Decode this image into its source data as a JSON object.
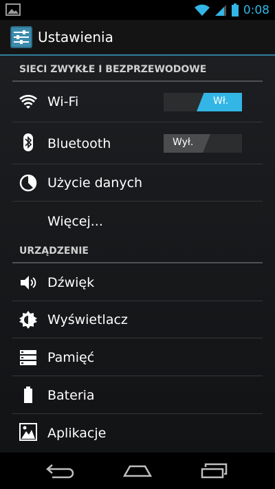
{
  "status_bar": {
    "time": "0:08",
    "icons": [
      "gallery-icon",
      "wifi-icon",
      "signal-icon",
      "battery-icon"
    ]
  },
  "action_bar": {
    "title": "Ustawienia",
    "icon": "settings-sliders-icon"
  },
  "sections": [
    {
      "header": "SIECI ZWYKŁE I BEZPRZEWODOWE",
      "items": [
        {
          "label": "Wi-Fi",
          "icon": "wifi-icon",
          "toggle": {
            "state": "on",
            "label": "Wł."
          }
        },
        {
          "label": "Bluetooth",
          "icon": "bluetooth-icon",
          "toggle": {
            "state": "off",
            "label": "Wył."
          }
        },
        {
          "label": "Użycie danych",
          "icon": "data-usage-icon"
        },
        {
          "label": "Więcej...",
          "icon": ""
        }
      ]
    },
    {
      "header": "URZĄDZENIE",
      "items": [
        {
          "label": "Dźwięk",
          "icon": "speaker-icon"
        },
        {
          "label": "Wyświetlacz",
          "icon": "brightness-icon"
        },
        {
          "label": "Pamięć",
          "icon": "storage-icon"
        },
        {
          "label": "Bateria",
          "icon": "battery-icon"
        },
        {
          "label": "Aplikacje",
          "icon": "apps-icon"
        }
      ]
    }
  ],
  "nav_bar": {
    "buttons": [
      "back-icon",
      "home-icon",
      "recent-apps-icon"
    ]
  },
  "colors": {
    "accent": "#33b5e5",
    "background": "#1c1e21",
    "divider": "#34373a"
  }
}
